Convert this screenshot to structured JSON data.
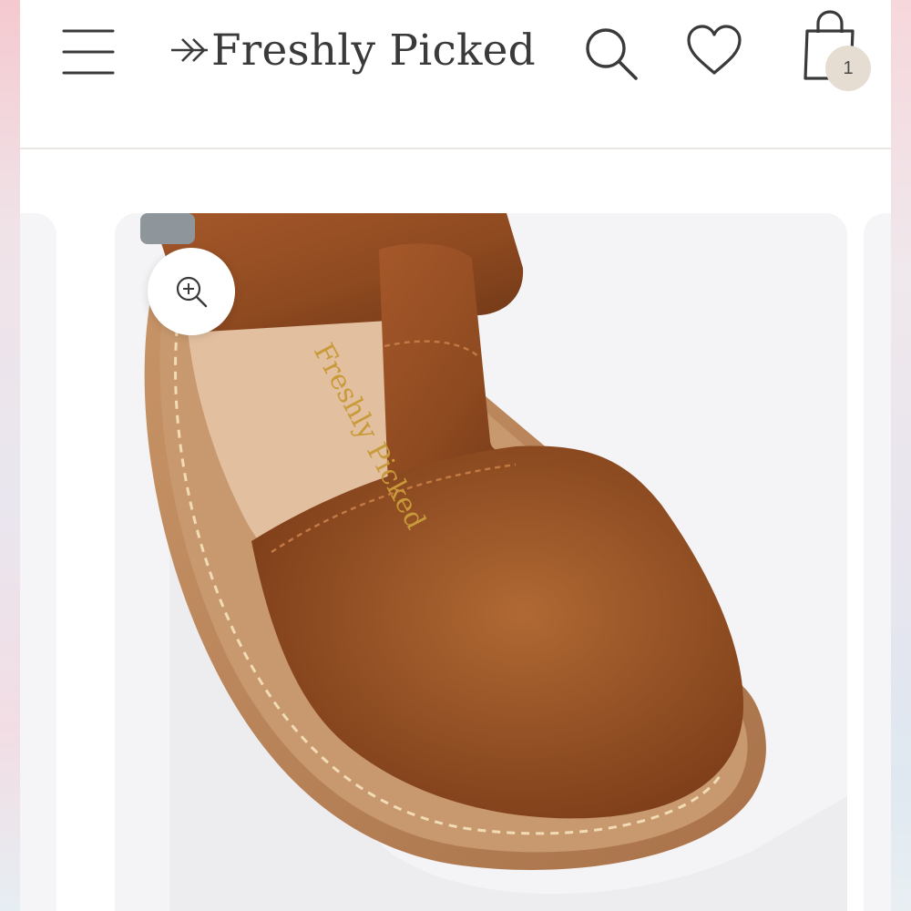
{
  "header": {
    "brand": "Freshly Picked",
    "menu_icon": "hamburger-menu-icon",
    "search_icon": "search-icon",
    "wishlist_icon": "heart-icon",
    "cart_icon": "shopping-bag-icon",
    "cart_count": "1"
  },
  "product": {
    "image_subject": "brown leather t-strap sandal",
    "insole_stamp": "Freshly Picked",
    "zoom_icon": "zoom-in-icon"
  },
  "colors": {
    "leather": "#8a4a22",
    "sole": "#b8835a",
    "insole": "#e3c1a2",
    "badge": "#e6ddd2",
    "text": "#3a3a3a"
  }
}
